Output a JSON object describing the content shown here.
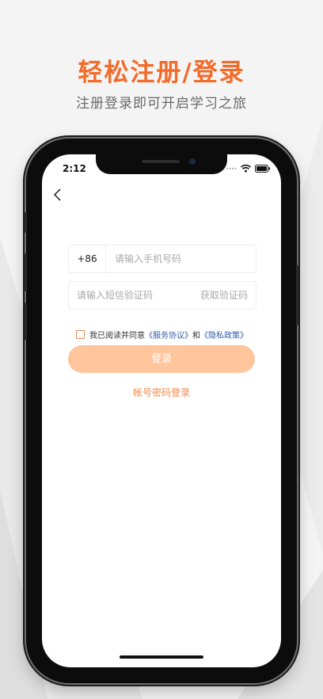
{
  "promo": {
    "headline": "轻松注册/登录",
    "subline": "注册登录即可开启学习之旅"
  },
  "status_bar": {
    "time": "2:12",
    "icons": [
      "signal-dots-icon",
      "wifi-icon",
      "battery-icon"
    ]
  },
  "nav": {
    "back_icon": "chevron-left-icon"
  },
  "form": {
    "country_code": "+86",
    "phone_placeholder": "请输入手机号码",
    "code_placeholder": "请输入短信验证码",
    "get_code_label": "获取验证码",
    "agreement": {
      "prefix": "我已阅读并同意",
      "service_link": "《服务协议》",
      "conjunction": "和",
      "privacy_link": "《隐私政策》",
      "checked": false
    },
    "login_button_label": "登录",
    "password_login_label": "帐号密码登录"
  },
  "colors": {
    "accent": "#f26b2a",
    "button_disabled": "#ffc59c",
    "link": "#2f5aa8",
    "secondary_text": "#a9a9a9"
  }
}
